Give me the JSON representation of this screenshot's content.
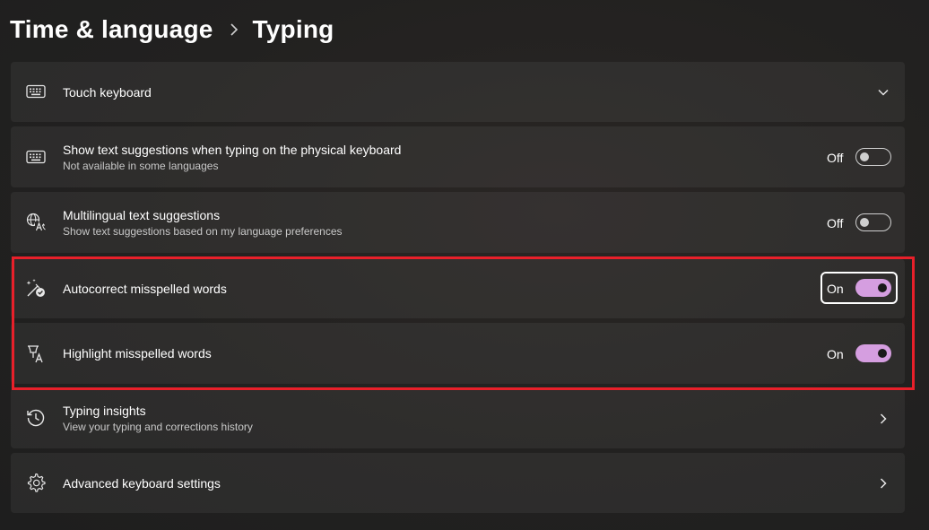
{
  "breadcrumb": {
    "parent": "Time & language",
    "current": "Typing"
  },
  "settings": [
    {
      "id": "touch-keyboard",
      "title": "Touch keyboard",
      "icon": "keyboard-icon",
      "control": "chevron-down"
    },
    {
      "id": "text-suggestions",
      "title": "Show text suggestions when typing on the physical keyboard",
      "subtitle": "Not available in some languages",
      "icon": "keyboard-icon",
      "control": "toggle",
      "state": "Off",
      "on": false
    },
    {
      "id": "multilingual",
      "title": "Multilingual text suggestions",
      "subtitle": "Show text suggestions based on my language preferences",
      "icon": "language-icon",
      "control": "toggle",
      "state": "Off",
      "on": false
    },
    {
      "id": "autocorrect",
      "title": "Autocorrect misspelled words",
      "icon": "autocorrect-icon",
      "control": "toggle",
      "state": "On",
      "on": true,
      "focused": true
    },
    {
      "id": "highlight",
      "title": "Highlight misspelled words",
      "icon": "highlight-text-icon",
      "control": "toggle",
      "state": "On",
      "on": true
    },
    {
      "id": "typing-insights",
      "title": "Typing insights",
      "subtitle": "View your typing and corrections history",
      "icon": "history-icon",
      "control": "chevron-right"
    },
    {
      "id": "advanced-keyboard",
      "title": "Advanced keyboard settings",
      "icon": "gear-icon",
      "control": "chevron-right"
    }
  ],
  "colors": {
    "background": "#202020",
    "card": "#2b2a29",
    "toggle_on": "#d59ee0",
    "annotation_box": "#e8202a"
  }
}
